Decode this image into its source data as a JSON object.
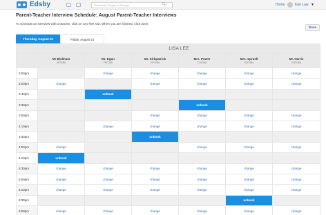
{
  "topbar": {
    "brand": "Edsby",
    "search_placeholder": "Search for People or Groups",
    "home_label": "Home",
    "user_name": "Ken Law",
    "icons": [
      "edsby-logo-icon",
      "messages-icon",
      "calendar-icon",
      "search-icon",
      "avatar-icon",
      "caret-down-icon"
    ]
  },
  "page": {
    "title": "Parent-Teacher Interview Schedule: August Parent-Teacher Interviews",
    "instructions": "To schedule an interview with a teacher, click on any free slot. When you are finished, click done.",
    "done_label": "Done"
  },
  "tabs": [
    {
      "label": "Thursday, August 20",
      "active": true
    },
    {
      "label": "Friday, August 21",
      "active": false
    }
  ],
  "student_name": "LISA LEE",
  "teachers": [
    {
      "name": "Mr Bickham",
      "code": "ARTOBA"
    },
    {
      "name": "Mr. Egan",
      "code": "FRCOBA"
    },
    {
      "name": "Mr. Kirkpatrick",
      "code": "PHYOBA"
    },
    {
      "name": "Mrs. Power",
      "code": "TCHOBA"
    },
    {
      "name": "Mrs. Spruell",
      "code": "SOCOBA"
    },
    {
      "name": "Mr. Harris",
      "code": "ENGOBA"
    }
  ],
  "rows": [
    {
      "time": "3:00pm",
      "cells": [
        "empty",
        "change",
        "change",
        "change",
        "change",
        "change"
      ]
    },
    {
      "time": "3:20pm",
      "cells": [
        "change",
        "empty",
        "change",
        "change",
        "change",
        "change"
      ]
    },
    {
      "time": "3:40pm",
      "cells": [
        "empty",
        "unbook",
        "empty",
        "empty",
        "empty",
        "empty"
      ]
    },
    {
      "time": "3:30pm",
      "cells": [
        "empty",
        "empty",
        "empty",
        "unbook",
        "empty",
        "empty"
      ]
    },
    {
      "time": "3:50pm",
      "cells": [
        "empty",
        "empty",
        "change",
        "change",
        "change",
        "change"
      ]
    },
    {
      "time": "4:10pm",
      "cells": [
        "empty",
        "change",
        "change",
        "change",
        "change",
        "change"
      ]
    },
    {
      "time": "4:30pm",
      "cells": [
        "empty",
        "empty",
        "unbook",
        "empty",
        "empty",
        "empty"
      ]
    },
    {
      "time": "4:50pm",
      "cells": [
        "change",
        "empty",
        "empty",
        "change",
        "change",
        "change"
      ]
    },
    {
      "time": "5:10pm",
      "cells": [
        "unbook",
        "empty",
        "empty",
        "empty",
        "empty",
        "empty"
      ]
    },
    {
      "time": "5:30pm",
      "cells": [
        "change",
        "change",
        "change",
        "change",
        "change",
        "change"
      ]
    },
    {
      "time": "5:50pm",
      "cells": [
        "change",
        "change",
        "change",
        "change",
        "change",
        "change"
      ]
    },
    {
      "time": "6:10pm",
      "cells": [
        "change",
        "change",
        "change",
        "change",
        "change",
        "change"
      ]
    },
    {
      "time": "6:30pm",
      "cells": [
        "empty",
        "empty",
        "empty",
        "empty",
        "unbook",
        "empty"
      ]
    },
    {
      "time": "6:50pm",
      "cells": [
        "change",
        "change",
        "change",
        "change",
        "change",
        "change"
      ]
    }
  ],
  "slot_labels": {
    "change": "change",
    "unbook": "unbook"
  },
  "colors": {
    "accent": "#1a8fe1",
    "link": "#2d6fb5",
    "empty_slot": "#efefef",
    "header_bg": "#e9e9e9"
  }
}
